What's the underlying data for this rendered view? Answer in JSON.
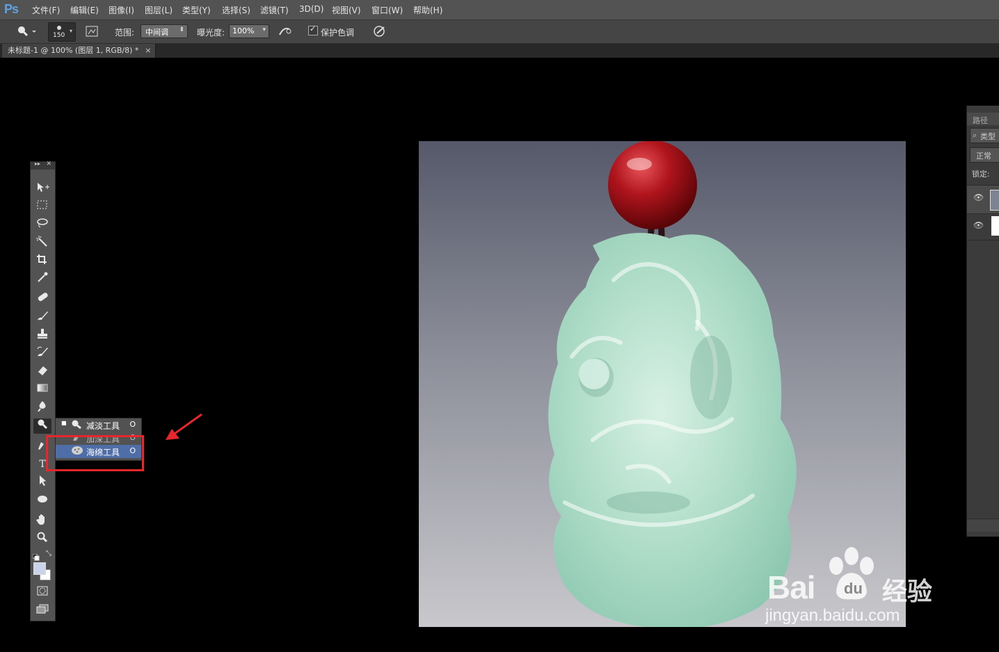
{
  "app": {
    "logo": "Ps"
  },
  "menu": [
    "文件(F)",
    "编辑(E)",
    "图像(I)",
    "图层(L)",
    "类型(Y)",
    "选择(S)",
    "滤镜(T)",
    "3D(D)",
    "视图(V)",
    "窗口(W)",
    "帮助(H)"
  ],
  "options": {
    "brush_size": "150",
    "range_label": "范围:",
    "range_value": "中间调",
    "exposure_label": "曝光度:",
    "exposure_value": "100%",
    "protect_tones_label": "保护色调"
  },
  "document_tab": {
    "title": "未标题-1 @ 100% (图层 1, RGB/8) *",
    "close": "×"
  },
  "toolbar": {
    "type_tool_glyph": "T"
  },
  "flyout": {
    "items": [
      {
        "name": "减淡工具",
        "key": "O"
      },
      {
        "name": "加深工具",
        "key": "O"
      },
      {
        "name": "海绵工具",
        "key": "O"
      }
    ]
  },
  "panel": {
    "tab": "路径",
    "search": "类型",
    "blend": "正常",
    "lock": "锁定:"
  },
  "watermark": {
    "brand": "Bai",
    "cn": "经验",
    "url": "jingyan.baidu.com"
  },
  "colors": {
    "highlight": "#e8262b",
    "selection": "#4f6ea8"
  }
}
